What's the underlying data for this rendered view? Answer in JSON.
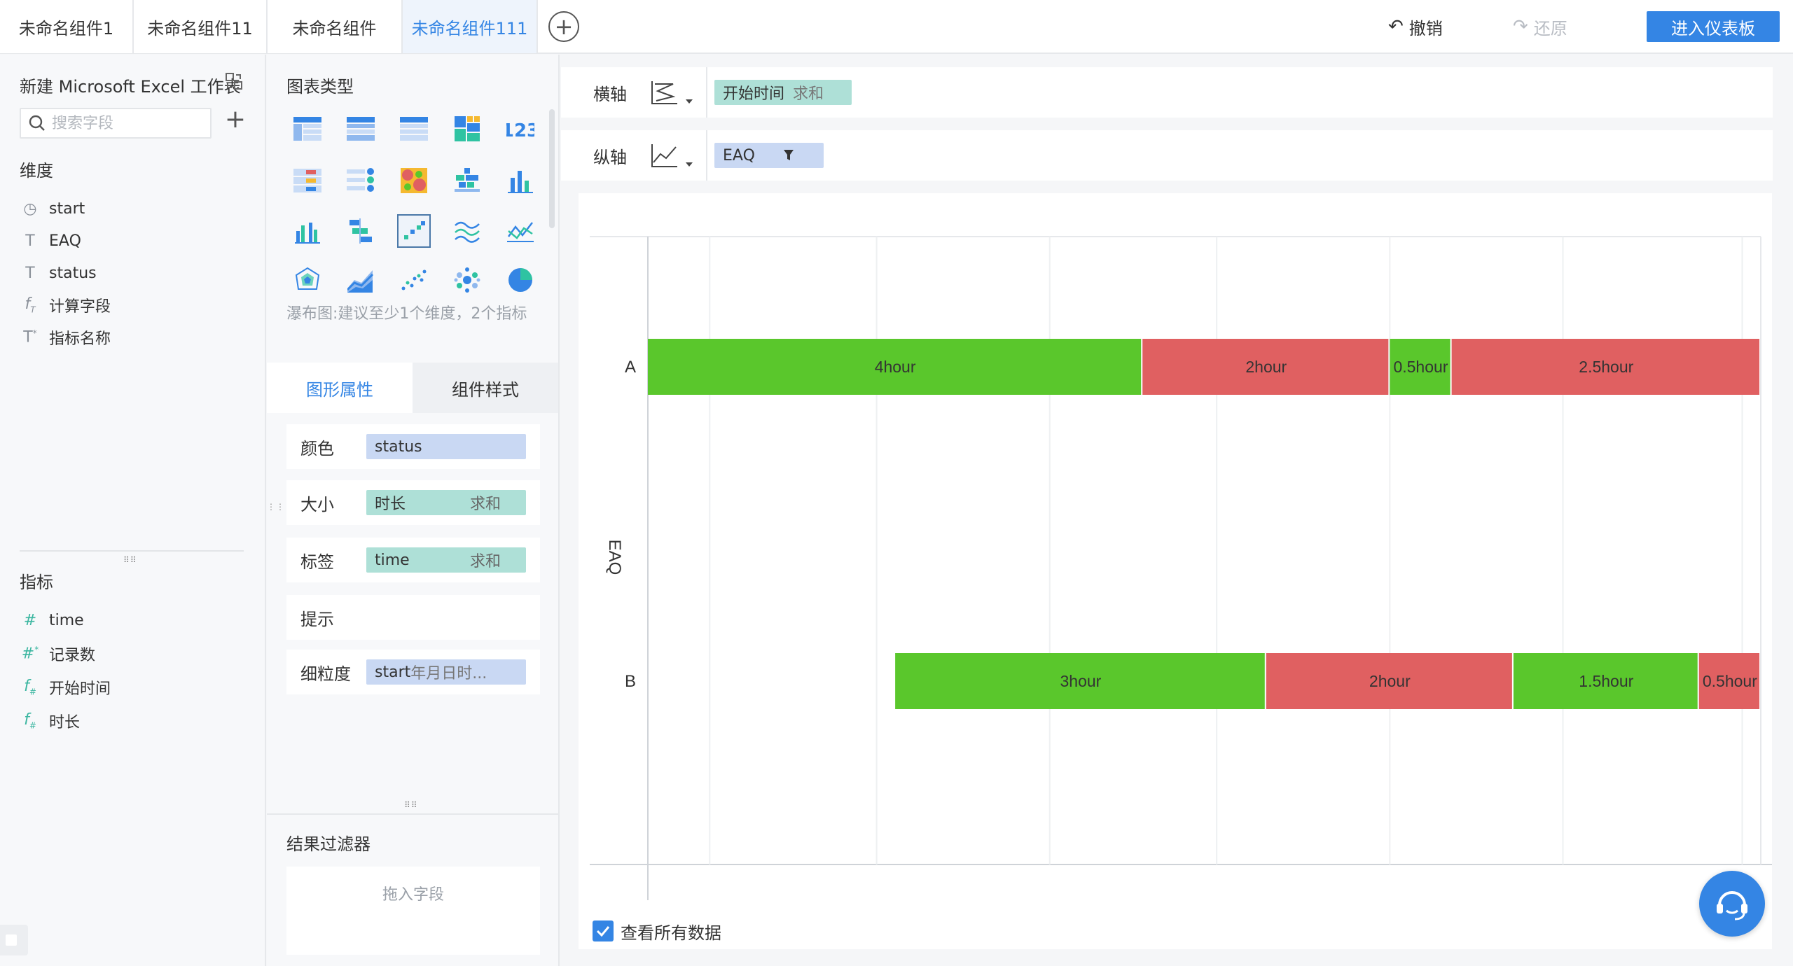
{
  "tabs": [
    {
      "label": "未命名组件1"
    },
    {
      "label": "未命名组件11"
    },
    {
      "label": "未命名组件"
    },
    {
      "label": "未命名组件111"
    }
  ],
  "header": {
    "undo_label": "撤销",
    "redo_label": "还原",
    "enter_dashboard_label": "进入仪表板"
  },
  "left": {
    "dataset_title": "新建 Microsoft Excel 工作表",
    "search_placeholder": "搜索字段",
    "dimension_label": "维度",
    "dimensions": [
      {
        "icon": "clock-icon",
        "label": "start"
      },
      {
        "icon": "text-field-icon",
        "label": "EAQ"
      },
      {
        "icon": "text-field-icon",
        "label": "status"
      },
      {
        "icon": "formula-text-icon",
        "label": "计算字段"
      },
      {
        "icon": "text-measure-icon",
        "label": "指标名称"
      }
    ],
    "measure_label": "指标",
    "measures": [
      {
        "icon": "number-field-icon",
        "label": "time"
      },
      {
        "icon": "number-count-icon",
        "label": "记录数"
      },
      {
        "icon": "formula-number-icon",
        "label": "开始时间"
      },
      {
        "icon": "formula-number-icon",
        "label": "时长"
      }
    ]
  },
  "middle": {
    "chart_type_title": "图表类型",
    "chart_hint": "瀑布图:建议至少1个维度，2个指标",
    "tab_graph_props": "图形属性",
    "tab_component_style": "组件样式",
    "props": {
      "color_label": "颜色",
      "color_value": "status",
      "size_label": "大小",
      "size_value": "时长",
      "size_agg": "求和",
      "tag_label": "标签",
      "tag_value": "time",
      "tag_agg": "求和",
      "tip_label": "提示",
      "granularity_label": "细粒度",
      "granularity_field": "start",
      "granularity_value": "年月日时..."
    },
    "result_filter_title": "结果过滤器",
    "drop_zone_text": "拖入字段"
  },
  "axes": {
    "x_label": "横轴",
    "x_field": "开始时间",
    "x_agg": "求和",
    "y_label": "纵轴",
    "y_field": "EAQ"
  },
  "view_all_label": "查看所有数据",
  "colors": {
    "accent": "#3485e4",
    "green": "#5ac72c",
    "red": "#e06061",
    "teal_chip": "#aee0d7",
    "blue_chip": "#c9d8f3"
  },
  "chart_data": {
    "type": "bar",
    "orientation": "horizontal",
    "ylabel": "EAQ",
    "categories": [
      "A",
      "B"
    ],
    "segments": {
      "A": [
        {
          "value": 4,
          "label": "4hour",
          "color": "#5ac72c"
        },
        {
          "value": 2,
          "label": "2hour",
          "color": "#e06061"
        },
        {
          "value": 0.5,
          "label": "0.5hour",
          "color": "#5ac72c"
        },
        {
          "value": 2.5,
          "label": "2.5hour",
          "color": "#e06061"
        }
      ],
      "B": [
        {
          "value": 2,
          "label": "",
          "color": "none"
        },
        {
          "value": 3,
          "label": "3hour",
          "color": "#5ac72c"
        },
        {
          "value": 2,
          "label": "2hour",
          "color": "#e06061"
        },
        {
          "value": 1.5,
          "label": "1.5hour",
          "color": "#5ac72c"
        },
        {
          "value": 0.5,
          "label": "0.5hour",
          "color": "#e06061"
        }
      ]
    },
    "xlim": [
      0,
      9
    ]
  }
}
